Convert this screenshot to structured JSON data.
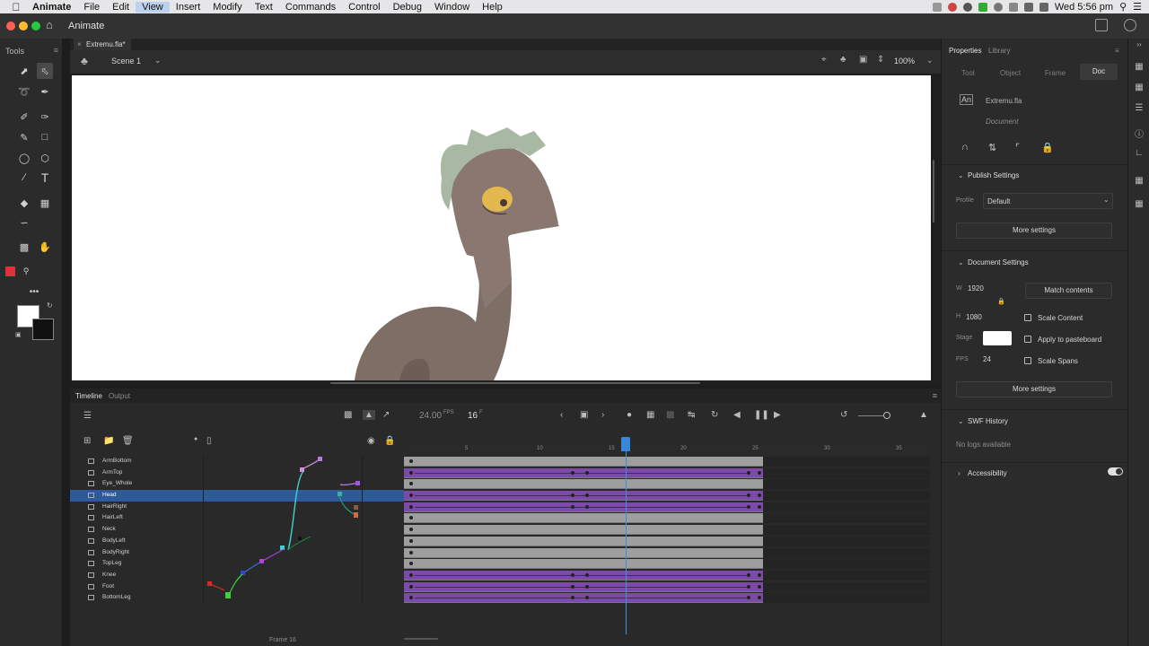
{
  "menubar": {
    "app": "Animate",
    "items": [
      "File",
      "Edit",
      "View",
      "Insert",
      "Modify",
      "Text",
      "Commands",
      "Control",
      "Debug",
      "Window",
      "Help"
    ],
    "active": "View",
    "clock": "Wed 5:56 pm"
  },
  "titlebar": {
    "appname": "Animate"
  },
  "tools": {
    "title": "Tools"
  },
  "document": {
    "tab": "Extremu.fla*",
    "scene": "Scene 1",
    "zoom": "100%"
  },
  "timeline": {
    "tab_timeline": "Timeline",
    "tab_output": "Output",
    "fps": "24.00",
    "fps_unit": "FPS",
    "current_frame": "16",
    "frame_unit": "F",
    "status": "Frame 16",
    "ruler_labels": [
      "5",
      "10",
      "15",
      "20",
      "25",
      "30",
      "35"
    ],
    "playhead_frame": 16,
    "layers": [
      {
        "name": "ArmBottom",
        "tween": false
      },
      {
        "name": "ArmTop",
        "tween": true
      },
      {
        "name": "Eye_Whole",
        "tween": false
      },
      {
        "name": "Head",
        "tween": true,
        "selected": true
      },
      {
        "name": "HairRight",
        "tween": true
      },
      {
        "name": "HairLeft",
        "tween": false
      },
      {
        "name": "Neck",
        "tween": false
      },
      {
        "name": "BodyLeft",
        "tween": false
      },
      {
        "name": "BodyRight",
        "tween": false
      },
      {
        "name": "TopLeg",
        "tween": false
      },
      {
        "name": "Knee",
        "tween": true
      },
      {
        "name": "Foot",
        "tween": true
      },
      {
        "name": "BottomLeg",
        "tween": true
      }
    ]
  },
  "properties": {
    "tab_properties": "Properties",
    "tab_library": "Library",
    "subtabs": [
      "Tool",
      "Object",
      "Frame",
      "Doc"
    ],
    "active_subtab": "Doc",
    "filename": "Extremu.fla",
    "doc_label": "Document",
    "publish": {
      "title": "Publish Settings",
      "profile_label": "Profile",
      "profile_value": "Default",
      "more": "More settings"
    },
    "docsettings": {
      "title": "Document Settings",
      "w_label": "W",
      "width": "1920",
      "h_label": "H",
      "height": "1080",
      "match": "Match contents",
      "scale_content": "Scale Content",
      "stage_label": "Stage",
      "apply_pasteboard": "Apply to pasteboard",
      "fps_label": "FPS",
      "fps": "24",
      "scale_spans": "Scale Spans",
      "more": "More settings"
    },
    "swf": {
      "title": "SWF History",
      "empty": "No logs available"
    },
    "accessibility": {
      "title": "Accessibility"
    }
  },
  "colors": {
    "tween": "#7c4aa8",
    "playhead": "#3a87d9",
    "selected_layer": "#2f5a9a",
    "stroke_color": "#e0303a"
  }
}
